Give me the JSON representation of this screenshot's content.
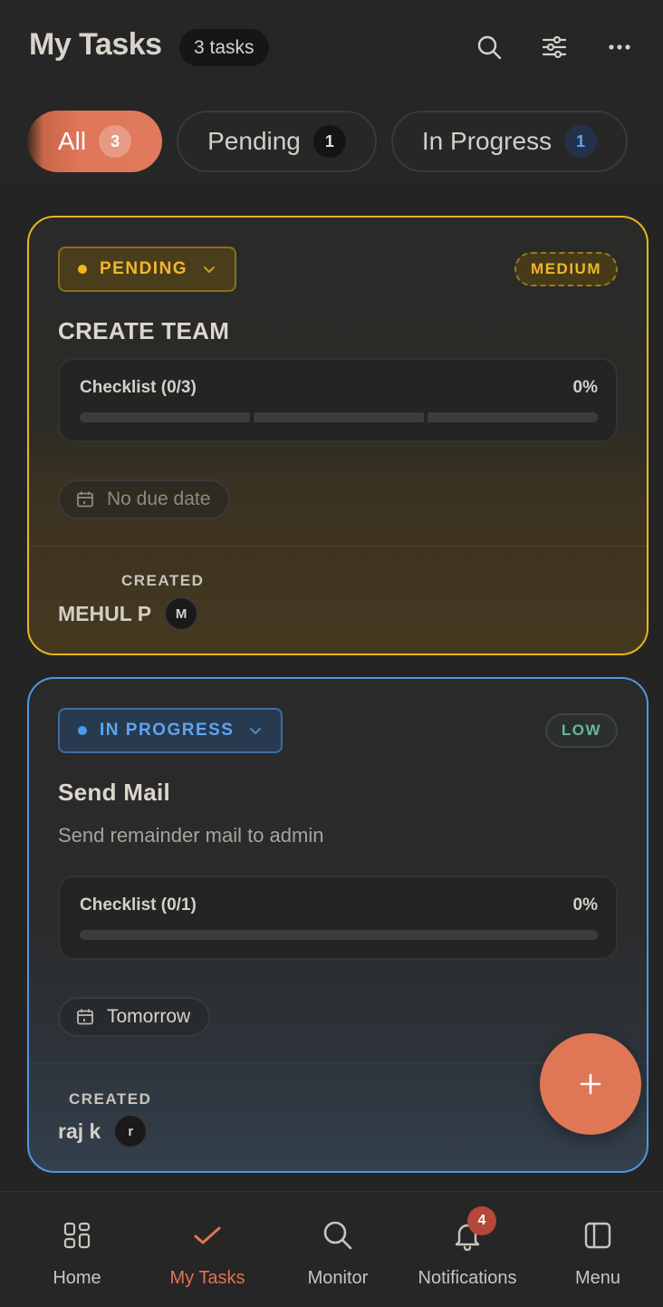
{
  "header": {
    "title": "My Tasks",
    "task_count": "3 tasks",
    "icons": [
      "search-icon",
      "filter-sliders-icon",
      "more-horizontal-icon"
    ]
  },
  "filters": [
    {
      "label": "All",
      "count": "3",
      "active": true
    },
    {
      "label": "Pending",
      "count": "1",
      "active": false
    },
    {
      "label": "In Progress",
      "count": "1",
      "active": false
    }
  ],
  "tasks": [
    {
      "status": "PENDING",
      "priority": "MEDIUM",
      "title": "CREATE TEAM",
      "description": "",
      "checklist_label": "Checklist (0/3)",
      "checklist_percent": "0%",
      "checklist_done": 0,
      "checklist_total": 3,
      "due": "No due date",
      "created_label": "CREATED",
      "creator": "MEHUL P",
      "avatar_initial": "M",
      "status_color": "#f2b61b"
    },
    {
      "status": "IN PROGRESS",
      "priority": "LOW",
      "title": "Send Mail",
      "description": "Send remainder mail to admin",
      "checklist_label": "Checklist (0/1)",
      "checklist_percent": "0%",
      "checklist_done": 0,
      "checklist_total": 1,
      "due": "Tomorrow",
      "created_label": "CREATED",
      "creator": "raj k",
      "avatar_initial": "r",
      "status_color": "#4d9bf0"
    }
  ],
  "fab": {
    "icon": "plus-icon"
  },
  "nav": {
    "items": [
      {
        "label": "Home",
        "icon": "home-grid-icon"
      },
      {
        "label": "My Tasks",
        "icon": "check-icon",
        "active": true
      },
      {
        "label": "Monitor",
        "icon": "search-icon"
      },
      {
        "label": "Notifications",
        "icon": "bell-icon",
        "badge": "4"
      },
      {
        "label": "Menu",
        "icon": "sidebar-panel-icon"
      }
    ]
  },
  "colors": {
    "accent": "#e07452",
    "pending": "#e9b51d",
    "in_progress": "#4f98e2",
    "background": "#242424"
  }
}
